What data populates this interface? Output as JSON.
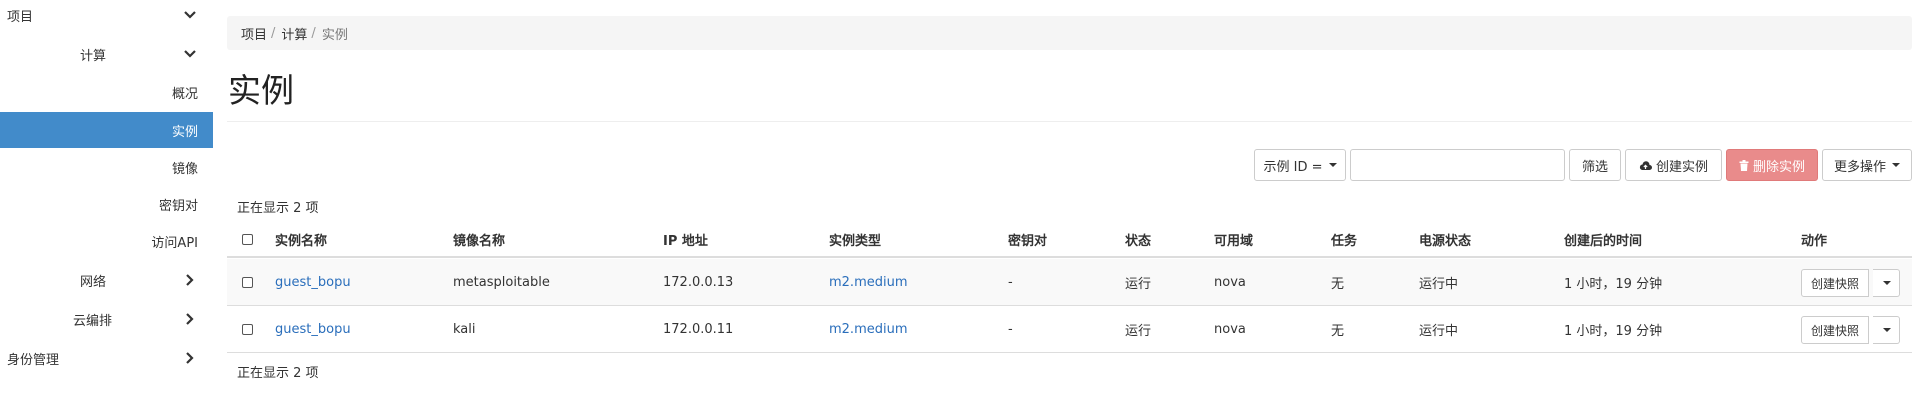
{
  "sidebar": {
    "project": "项目",
    "compute": "计算",
    "overview": "概况",
    "instances": "实例",
    "images": "镜像",
    "keypairs": "密钥对",
    "api_access": "访问API",
    "network": "网络",
    "orchestration": "云编排",
    "identity": "身份管理"
  },
  "breadcrumb": {
    "project": "项目",
    "compute": "计算",
    "current": "实例",
    "sep": "/"
  },
  "page_title": "实例",
  "toolbar": {
    "filter_field": "示例 ID =",
    "filter_input_value": "",
    "filter_button": "筛选",
    "create_button": "创建实例",
    "delete_button": "删除实例",
    "more_button": "更多操作"
  },
  "count_text": "正在显示 2 项",
  "table": {
    "headers": [
      "实例名称",
      "镜像名称",
      "IP 地址",
      "实例类型",
      "密钥对",
      "状态",
      "可用域",
      "任务",
      "电源状态",
      "创建后的时间",
      "动作"
    ],
    "rows": [
      {
        "name": "guest_bopu",
        "image": "metasploitable",
        "ip": "172.0.0.13",
        "flavor": "m2.medium",
        "keypair": "-",
        "status": "运行",
        "zone": "nova",
        "task": "无",
        "power": "运行中",
        "age": "1 小时，19 分钟",
        "action": "创建快照"
      },
      {
        "name": "guest_bopu",
        "image": "kali",
        "ip": "172.0.0.11",
        "flavor": "m2.medium",
        "keypair": "-",
        "status": "运行",
        "zone": "nova",
        "task": "无",
        "power": "运行中",
        "age": "1 小时，19 分钟",
        "action": "创建快照"
      }
    ]
  },
  "colors": {
    "active_nav": "#428bca",
    "link": "#2a6ebb",
    "danger": "#e98b8b"
  }
}
